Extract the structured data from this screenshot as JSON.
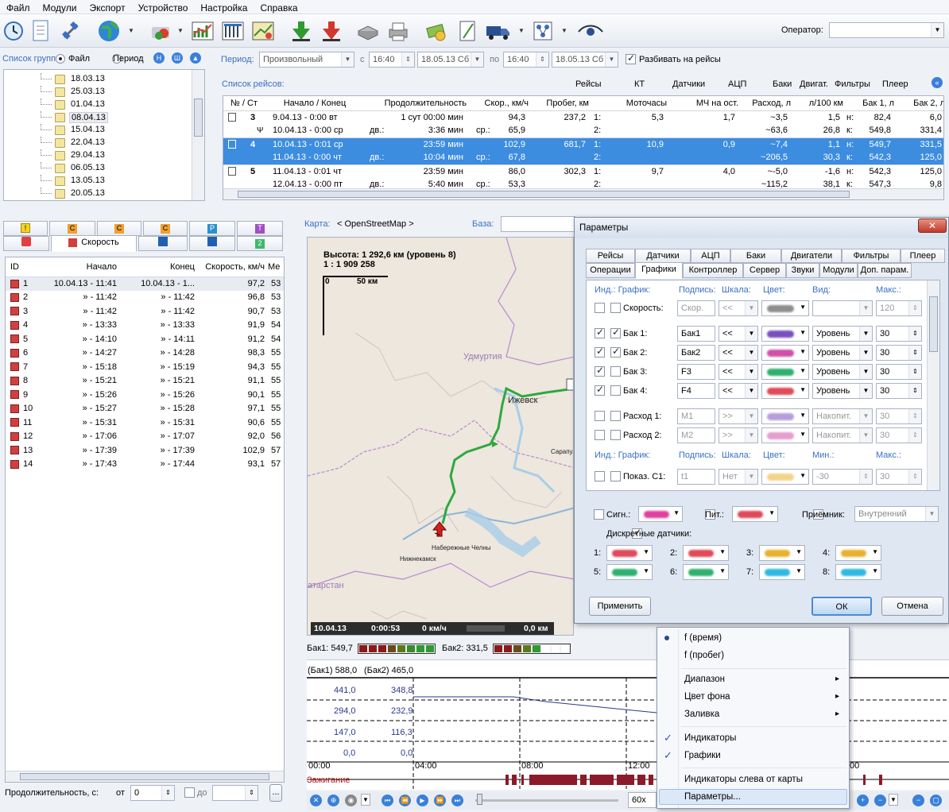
{
  "menu": [
    "Файл",
    "Модули",
    "Экспорт",
    "Устройство",
    "Настройка",
    "Справка"
  ],
  "toolbar": {
    "operator_label": "Оператор:",
    "operator_value": "",
    "icons": [
      "clock-icon",
      "document-icon",
      "satellite-icon",
      "globe-icon",
      "print-color-icon",
      "chart-report-icon",
      "table-report-icon",
      "map-edit-icon",
      "arrow-down-green-icon",
      "arrow-down-red-icon",
      "scanner-icon",
      "printer-icon",
      "money-icon",
      "ruler-doc-icon",
      "truck-icon",
      "network-icon",
      "eye-icon"
    ]
  },
  "groups": {
    "list_label": "Список групп",
    "mode_file": "Файл",
    "mode_period": "Период",
    "items": [
      "18.03.13",
      "25.03.13",
      "01.04.13",
      "08.04.13",
      "15.04.13",
      "22.04.13",
      "29.04.13",
      "06.05.13",
      "13.05.13",
      "20.05.13"
    ],
    "selected_index": 3
  },
  "period": {
    "label": "Период:",
    "value": "Произвольный",
    "from_label": "с",
    "from_time": "16:40",
    "from_date": "18.05.13 Сб",
    "to_label": "по",
    "to_time": "16:40",
    "to_date": "18.05.13 Сб",
    "split_label": "Разбивать на рейсы",
    "split_checked": true
  },
  "trips": {
    "title": "Список рейсов:",
    "header_tabs": [
      "Рейсы",
      "КТ",
      "Датчики",
      "АЦП",
      "Баки",
      "Двигат.",
      "Фильтры",
      "Плеер"
    ],
    "columns": [
      "№ / Ст",
      "Начало / Конец",
      "Продолжительность",
      "Скор., км/ч",
      "Пробег, км",
      "Моточасы",
      "МЧ на ост.",
      "Расход, л",
      "л/100 км",
      "Бак 1, л",
      "Бак 2, л"
    ],
    "rows": [
      {
        "no": "3",
        "start": "9.04.13 -  0:00  вт",
        "end": "10.04.13 -  0:00  ср",
        "dur1": "1 сут 00:00 мин",
        "dur2_label": "дв.:",
        "dur2": "3:36 мин",
        "speed1": "94,3",
        "speed_label": "ср.:",
        "speed2": "65,9",
        "mileage": "237,2",
        "moto1": "1:",
        "moto1v": "5,3",
        "moto2": "2:",
        "mch": "1,7",
        "fuel1": "~3,5",
        "fuel2": "~63,6",
        "l100a": "1,5",
        "l100b": "26,8",
        "tk1": "н:",
        "tk2": "к:",
        "b1a": "82,4",
        "b1b": "549,8",
        "b2a": "6,0",
        "b2b": "331,4"
      },
      {
        "no": "4",
        "start": "10.04.13 -  0:01  ср",
        "end": "11.04.13 -  0:00  чт",
        "dur1": "23:59 мин",
        "dur2_label": "дв.:",
        "dur2": "10:04 мин",
        "speed1": "102,9",
        "speed_label": "ср.:",
        "speed2": "67,8",
        "mileage": "681,7",
        "moto1": "1:",
        "moto1v": "10,9",
        "moto2": "2:",
        "mch": "0,9",
        "fuel1": "~7,4",
        "fuel2": "~206,5",
        "l100a": "1,1",
        "l100b": "30,3",
        "tk1": "н:",
        "tk2": "к:",
        "b1a": "549,7",
        "b1b": "542,3",
        "b2a": "331,5",
        "b2b": "125,0"
      },
      {
        "no": "5",
        "start": "11.04.13 -  0:01  чт",
        "end": "12.04.13 -  0:00  пт",
        "dur1": "23:59 мин",
        "dur2_label": "дв.:",
        "dur2": "5:40 мин",
        "speed1": "86,0",
        "speed_label": "ср.:",
        "speed2": "53,3",
        "mileage": "302,3",
        "moto1": "1:",
        "moto1v": "9,7",
        "moto2": "2:",
        "mch": "4,0",
        "fuel1": "~-5,0",
        "fuel2": "~115,2",
        "l100a": "-1,6",
        "l100b": "38,1",
        "tk1": "н:",
        "tk2": "к:",
        "b1a": "542,3",
        "b1b": "547,3",
        "b2a": "125,0",
        "b2b": "9,8"
      }
    ]
  },
  "speed_panel": {
    "tab_label": "Скорость",
    "columns": [
      "ID",
      "Начало",
      "Конец",
      "Скорость, км/ч",
      "Ме"
    ],
    "rows": [
      [
        "1",
        "10.04.13 - 11:41",
        "10.04.13 - 1...",
        "97,2",
        "53"
      ],
      [
        "2",
        "» - 11:42",
        "» - 11:42",
        "96,8",
        "53"
      ],
      [
        "3",
        "» - 11:42",
        "» - 11:42",
        "90,7",
        "53"
      ],
      [
        "4",
        "» - 13:33",
        "» - 13:33",
        "91,9",
        "54"
      ],
      [
        "5",
        "» - 14:10",
        "» - 14:11",
        "91,2",
        "54"
      ],
      [
        "6",
        "» - 14:27",
        "» - 14:28",
        "98,3",
        "55"
      ],
      [
        "7",
        "» - 15:18",
        "» - 15:19",
        "94,3",
        "55"
      ],
      [
        "8",
        "» - 15:21",
        "» - 15:21",
        "91,1",
        "55"
      ],
      [
        "9",
        "» - 15:26",
        "» - 15:26",
        "90,1",
        "55"
      ],
      [
        "10",
        "» - 15:27",
        "» - 15:28",
        "97,1",
        "55"
      ],
      [
        "11",
        "» - 15:31",
        "» - 15:31",
        "90,6",
        "55"
      ],
      [
        "12",
        "» - 17:06",
        "» - 17:07",
        "92,0",
        "56"
      ],
      [
        "13",
        "» - 17:39",
        "» - 17:39",
        "102,9",
        "57"
      ],
      [
        "14",
        "» - 17:43",
        "» - 17:44",
        "93,1",
        "57"
      ]
    ],
    "duration_label": "Продолжительность, с:",
    "from_label": "от",
    "from_value": "0",
    "to_label": "до",
    "to_value": ""
  },
  "map": {
    "label": "Карта:",
    "source": "< OpenStreetMap >",
    "base_label": "База:",
    "altitude": "Высота: 1 292,6 км (уровень 8)",
    "scale": "1 : 1 909 258",
    "scale_0": "0",
    "scale_50": "50 км",
    "region": "Удмуртия",
    "cities": [
      "Ижевск",
      "Сарапул",
      "Набережные Челны",
      "Нижнекамск",
      "атарстан"
    ],
    "status_date": "10.04.13",
    "status_time": "0:00:53",
    "status_speed": "0 км/ч",
    "status_km": "0,0 км"
  },
  "indicators": {
    "tank1": "Бак1: 549,7",
    "tank2": "Бак2: 331,5"
  },
  "graph": {
    "header1": "(Бак1) 588,0",
    "header2": "(Бак2) 465,0",
    "y1": [
      "441,0",
      "294,0",
      "147,0",
      "0,0"
    ],
    "y2": [
      "348,8",
      "232,9",
      "116,3",
      "0,0"
    ],
    "x_ticks": [
      "00:00",
      "04:00",
      "08:00",
      "12:00",
      ":00"
    ],
    "ignition_label": "Зажигание",
    "zoom": "60x"
  },
  "params": {
    "title": "Параметры",
    "tabs_row1": [
      "Рейсы",
      "Датчики",
      "АЦП",
      "Баки",
      "Двигатели",
      "Фильтры",
      "Плеер"
    ],
    "tabs_row2": [
      "Операции",
      "Графики",
      "Контроллер",
      "Сервер",
      "Звуки",
      "Модули",
      "Доп. парам."
    ],
    "active_tab": "Графики",
    "hdr": [
      "Инд.: График:",
      "Подпись:",
      "Шкала:",
      "Цвет:",
      "Вид:",
      "Макс.:"
    ],
    "hdr2": [
      "Инд.: График:",
      "Подпись:",
      "Шкала:",
      "Цвет:",
      "Мин.:",
      "Макс.:"
    ],
    "rows": [
      {
        "label": "Скорость:",
        "caption": "Скор.",
        "scale": "<<",
        "view": "",
        "max": "120",
        "c1": false,
        "c2": false,
        "color": "#333333"
      },
      {
        "label": "Бак 1:",
        "caption": "Бак1",
        "scale": "<<",
        "view": "Уровень",
        "max": "30",
        "c1": true,
        "c2": true,
        "color": "#7a4fc0"
      },
      {
        "label": "Бак 2:",
        "caption": "Бак2",
        "scale": "<<",
        "view": "Уровень",
        "max": "30",
        "c1": true,
        "c2": true,
        "color": "#d04fa8"
      },
      {
        "label": "Бак 3:",
        "caption": "F3",
        "scale": "<<",
        "view": "Уровень",
        "max": "30",
        "c1": true,
        "c2": false,
        "color": "#2fb070"
      },
      {
        "label": "Бак 4:",
        "caption": "F4",
        "scale": "<<",
        "view": "Уровень",
        "max": "30",
        "c1": true,
        "c2": false,
        "color": "#e04a5a"
      },
      {
        "label": "Расход 1:",
        "caption": "M1",
        "scale": ">>",
        "view": "Накопит.",
        "max": "30",
        "c1": false,
        "c2": false,
        "color": "#7a4fc0"
      },
      {
        "label": "Расход 2:",
        "caption": "M2",
        "scale": ">>",
        "view": "Накопит.",
        "max": "30",
        "c1": false,
        "c2": false,
        "color": "#d04fa8"
      },
      {
        "label": "Показ. С1:",
        "caption": "t1",
        "scale": "Нет",
        "view": "-30",
        "max": "30",
        "c1": false,
        "c2": false,
        "color": "#e8b030"
      }
    ],
    "signal_label": "Сигн.:",
    "power_label": "Пит.:",
    "receiver_label": "Приёмник:",
    "receiver_value": "Внутренний",
    "discrete_label": "Дискретные датчики:",
    "discrete_checked": true,
    "discrete": [
      {
        "n": "1:",
        "color": "#e04a5a"
      },
      {
        "n": "2:",
        "color": "#e04a5a"
      },
      {
        "n": "3:",
        "color": "#e8b030"
      },
      {
        "n": "4:",
        "color": "#e8b030"
      },
      {
        "n": "5:",
        "color": "#2fb070"
      },
      {
        "n": "6:",
        "color": "#2fb070"
      },
      {
        "n": "7:",
        "color": "#30b8e0"
      },
      {
        "n": "8:",
        "color": "#30b8e0"
      }
    ],
    "apply": "Применить",
    "ok": "ОК",
    "cancel": "Отмена"
  },
  "context_menu": {
    "f_time": "f (время)",
    "f_mileage": "f (пробег)",
    "range": "Диапазон",
    "bg_color": "Цвет фона",
    "fill": "Заливка",
    "indicators": "Индикаторы",
    "graphs": "Графики",
    "left_indicators": "Индикаторы слева от карты",
    "parameters": "Параметры..."
  }
}
